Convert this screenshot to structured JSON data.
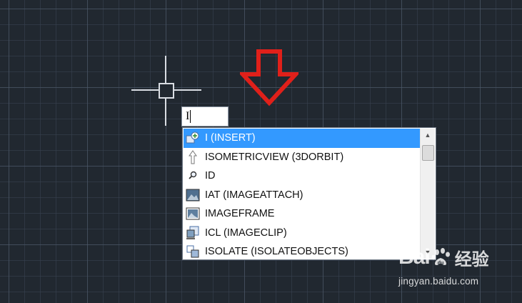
{
  "command_input": {
    "value": "I"
  },
  "autocomplete": {
    "selected_index": 0,
    "items": [
      {
        "label": "I (INSERT)",
        "icon": "insert-block-icon"
      },
      {
        "label": "ISOMETRICVIEW (3DORBIT)",
        "icon": "orbit-arrow-icon"
      },
      {
        "label": "ID",
        "icon": "id-magnifier-icon"
      },
      {
        "label": "IAT (IMAGEATTACH)",
        "icon": "image-attach-icon"
      },
      {
        "label": "IMAGEFRAME",
        "icon": "image-frame-icon"
      },
      {
        "label": "ICL (IMAGECLIP)",
        "icon": "image-clip-icon"
      },
      {
        "label": "ISOLATE (ISOLATEOBJECTS)",
        "icon": "isolate-objects-icon"
      }
    ]
  },
  "annotation": {
    "arrow_color": "#e0201a",
    "icon": "down-arrow-icon"
  },
  "watermark": {
    "brand": "Bai",
    "brand_cn": "经验",
    "url": "jingyan.baidu.com"
  },
  "colors": {
    "canvas_bg": "#212830",
    "selection": "#3399ff",
    "crosshair": "#d9dde3"
  }
}
